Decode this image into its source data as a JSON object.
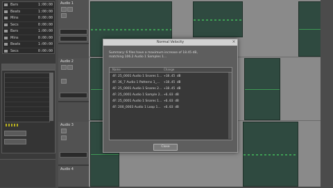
{
  "left_panel": {
    "stats": [
      {
        "label": "Bars",
        "value": "1:00:00"
      },
      {
        "label": "Beats",
        "value": "1:00:00"
      },
      {
        "label": "Mins",
        "value": "0:00:00"
      },
      {
        "label": "Secs",
        "value": "0:00:00"
      },
      {
        "label": "Bars",
        "value": "1:00:00"
      },
      {
        "label": "Mins",
        "value": "0:00:00"
      },
      {
        "label": "Beats",
        "value": "1:00:00"
      },
      {
        "label": "Secs",
        "value": "0:00:00"
      }
    ]
  },
  "tracks": [
    {
      "name": "Audio 1"
    },
    {
      "name": "Audio 2"
    },
    {
      "name": "Audio 3"
    },
    {
      "name": "Audio 4"
    }
  ],
  "dialog": {
    "title": "Normal Velocity",
    "close_icon": "close-icon",
    "message_line1": "Summary: 6 files have a maximum increase of 18.45 dB,",
    "message_line2": "matching 106.2 Audio 1 Samples 1...",
    "list_columns": [
      "Name",
      "Change"
    ],
    "rows": [
      {
        "name": "4F: 25_0001 Audio 1 Snares 1...",
        "change": "+18.45 dB"
      },
      {
        "name": "4F: 36_7 Audio 1 Patterns 1_...",
        "change": "+18.45 dB"
      },
      {
        "name": "4F: 25_0001 Audio 1 Snares 2...",
        "change": "+18.45 dB"
      },
      {
        "name": "4F: 25_0001 Audio 1 Sample 2...",
        "change": "+6.03 dB"
      },
      {
        "name": "4F: 25_0001 Audio 1 Snares 1...",
        "change": "+6.03 dB"
      },
      {
        "name": "4F: 200_0003 Audio 1 Loop 1...",
        "change": "+6.03 dB"
      }
    ],
    "ok_label": "Close"
  }
}
